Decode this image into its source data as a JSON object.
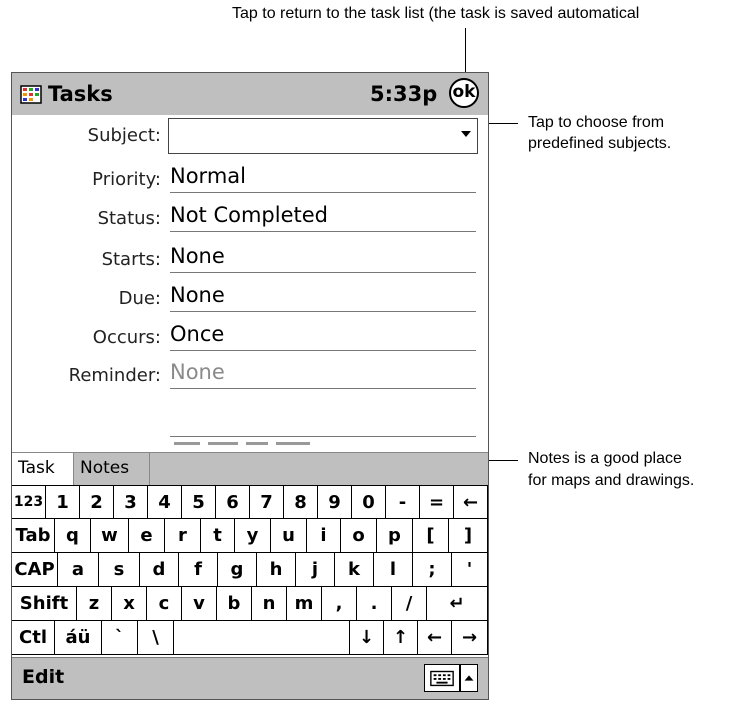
{
  "callouts": {
    "ok": "Tap to return to the task list (the task is saved automatical",
    "subject": [
      "Tap to choose from",
      "predefined subjects."
    ],
    "notes": [
      "Notes is a good place",
      "for maps and drawings."
    ]
  },
  "titlebar": {
    "app_icon": "tasks-app-icon",
    "title": "Tasks",
    "time": "5:33p",
    "ok_label": "ok"
  },
  "form": {
    "subject": {
      "label": "Subject:",
      "value": ""
    },
    "priority": {
      "label": "Priority:",
      "value": "Normal"
    },
    "status": {
      "label": "Status:",
      "value": "Not Completed"
    },
    "starts": {
      "label": "Starts:",
      "value": "None"
    },
    "due": {
      "label": "Due:",
      "value": "None"
    },
    "occurs": {
      "label": "Occurs:",
      "value": "Once"
    },
    "reminder": {
      "label": "Reminder:",
      "value": "None"
    }
  },
  "tabs": {
    "task": "Task",
    "notes": "Notes"
  },
  "keyboard": {
    "rows": [
      [
        "123",
        "1",
        "2",
        "3",
        "4",
        "5",
        "6",
        "7",
        "8",
        "9",
        "0",
        "-",
        "=",
        "←"
      ],
      [
        "Tab",
        "q",
        "w",
        "e",
        "r",
        "t",
        "y",
        "u",
        "i",
        "o",
        "p",
        "[",
        "]"
      ],
      [
        "CAP",
        "a",
        "s",
        "d",
        "f",
        "g",
        "h",
        "j",
        "k",
        "l",
        ";",
        "'"
      ],
      [
        "Shift",
        "z",
        "x",
        "c",
        "v",
        "b",
        "n",
        "m",
        ",",
        ".",
        "/",
        "↵"
      ],
      [
        "Ctl",
        "áü",
        "`",
        "\\",
        " ",
        "↓",
        "↑",
        "←",
        "→"
      ]
    ]
  },
  "commandbar": {
    "edit": "Edit",
    "keyboard_icon": "keyboard-icon",
    "sip_arrow_icon": "chevron-up-icon"
  }
}
